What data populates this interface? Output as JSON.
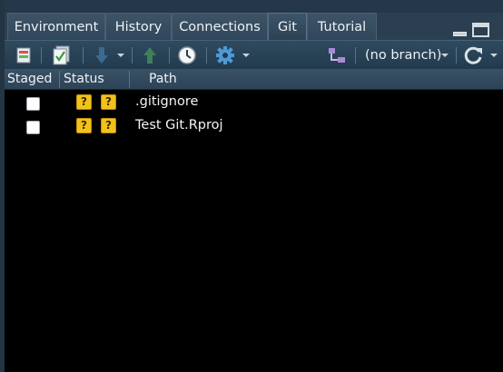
{
  "tabs": [
    {
      "label": "Environment"
    },
    {
      "label": "History"
    },
    {
      "label": "Connections"
    },
    {
      "label": "Git"
    },
    {
      "label": "Tutorial"
    }
  ],
  "active_tab": "Git",
  "toolbar": {
    "branch": "(no branch)",
    "icons": [
      "diff-icon",
      "commit-icon",
      "pull-icon",
      "push-icon",
      "history-icon",
      "gear-icon",
      "new-branch-icon",
      "refresh-icon"
    ]
  },
  "columns": {
    "staged": "Staged",
    "status": "Status",
    "path": "Path"
  },
  "files": [
    {
      "staged": false,
      "status_index": "?",
      "status_worktree": "?",
      "path": ".gitignore"
    },
    {
      "staged": false,
      "status_index": "?",
      "status_worktree": "?",
      "path": "Test Git.Rproj"
    }
  ],
  "colors": {
    "status_untracked": "#f2c21c",
    "toolbar_bg": "#2f4a5f",
    "list_bg": "#000000"
  }
}
